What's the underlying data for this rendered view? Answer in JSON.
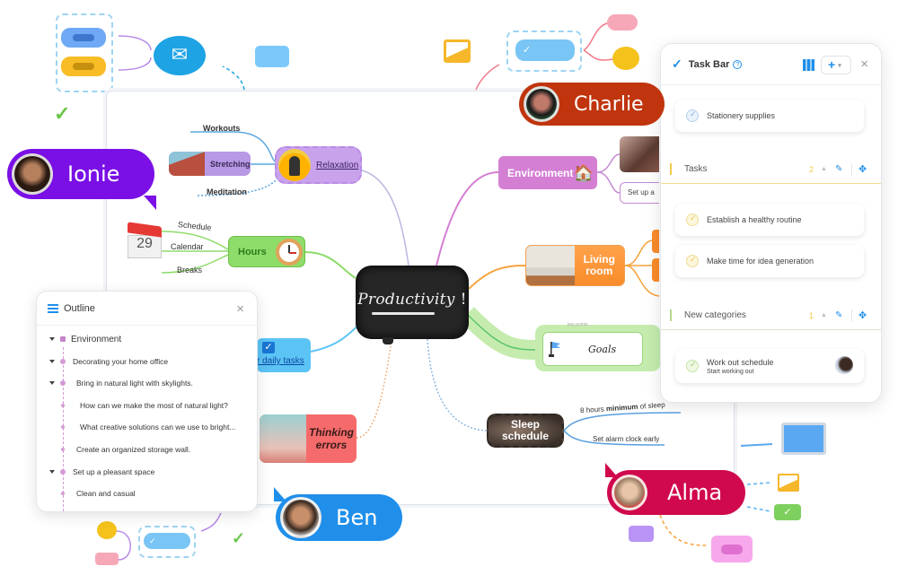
{
  "mindmap": {
    "central": {
      "label": "Productivity",
      "exclaim": "!"
    },
    "left_branches": {
      "relaxation": {
        "label": "Relaxation",
        "children": [
          "Workouts",
          "Stretching",
          "Meditation"
        ]
      },
      "hours": {
        "label": "Hours",
        "children": [
          "Schedule",
          "Calendar",
          "Breaks"
        ],
        "calendar_day": "29"
      },
      "daily_tasks": {
        "label": "r daily tasks"
      },
      "thinking_errors": {
        "label": "Thinking errors"
      }
    },
    "right_branches": {
      "environment": {
        "label": "Environment",
        "icon": "🏠",
        "child_text": "Set up a"
      },
      "living_room": {
        "label": "Living room"
      },
      "goals": {
        "label": "Goals",
        "top_caption": "key points"
      },
      "sleep": {
        "label": "Sleep schedule",
        "children": [
          {
            "pre": "8 hours ",
            "bold": "minimum",
            "post": " of sleep"
          },
          {
            "pre": "Set alarm clock early",
            "bold": "",
            "post": ""
          }
        ]
      }
    }
  },
  "collaborators": [
    {
      "name": "Ionie",
      "color": "#7a0fe6"
    },
    {
      "name": "Charlie",
      "color": "#c0350e"
    },
    {
      "name": "Alma",
      "color": "#d0084d"
    },
    {
      "name": "Ben",
      "color": "#1f8fea"
    }
  ],
  "outline": {
    "title": "Outline",
    "close": "×",
    "items": [
      {
        "text": "Environment",
        "level": 0,
        "expanded": true
      },
      {
        "text": "Decorating your home office",
        "level": 1,
        "expanded": true
      },
      {
        "text": "Bring in natural light with skylights.",
        "level": 2,
        "expanded": true
      },
      {
        "text": "How can we make the most of natural light?",
        "level": 3,
        "expanded": false
      },
      {
        "text": "What creative solutions can we use to bright...",
        "level": 3,
        "expanded": false
      },
      {
        "text": "Create an organized storage wall.",
        "level": 2,
        "expanded": false
      },
      {
        "text": "Set up a pleasant space",
        "level": 1,
        "expanded": true
      },
      {
        "text": "Clean and casual",
        "level": 2,
        "expanded": false
      }
    ]
  },
  "taskbar": {
    "title": "Task Bar",
    "help": "?",
    "add": "+",
    "close": "×",
    "loose_tasks": [
      {
        "title": "Stationery supplies",
        "done": false
      }
    ],
    "sections": [
      {
        "name": "Tasks",
        "count": "2",
        "color": "#f2c94c",
        "tasks": [
          {
            "title": "Establish a healthy routine"
          },
          {
            "title": "Make time for idea generation"
          }
        ]
      },
      {
        "name": "New categories",
        "count": "1",
        "color": "#b5d98a",
        "tasks": [
          {
            "title": "Work out schedule",
            "subtitle": "Start working out"
          }
        ]
      }
    ]
  },
  "icons": {
    "check": "✓",
    "caret_up": "▲",
    "caret_down": "▾",
    "pencil": "✎",
    "move": "✥",
    "mail": "✉"
  }
}
